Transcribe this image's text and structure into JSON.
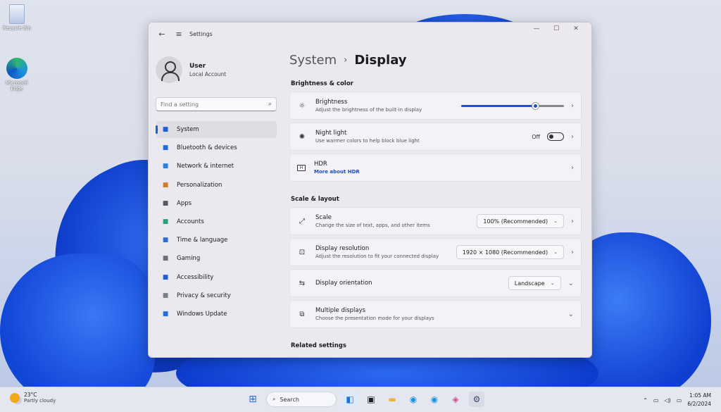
{
  "desktop": {
    "icons": [
      {
        "label": "Recycle Bin"
      },
      {
        "label": "Microsoft Edge"
      }
    ]
  },
  "window": {
    "title": "Settings",
    "controls": {
      "minimize": "—",
      "maximize": "☐",
      "close": "✕"
    }
  },
  "sidebar": {
    "user_name": "User",
    "user_account": "Local Account",
    "search_placeholder": "Find a setting",
    "items": [
      {
        "label": "System",
        "icon": "monitor-icon",
        "color": "#1f5fcf"
      },
      {
        "label": "Bluetooth & devices",
        "icon": "bluetooth-icon",
        "color": "#1f6fd8"
      },
      {
        "label": "Network & internet",
        "icon": "wifi-icon",
        "color": "#2a7fe0"
      },
      {
        "label": "Personalization",
        "icon": "brush-icon",
        "color": "#d07a2a"
      },
      {
        "label": "Apps",
        "icon": "apps-icon",
        "color": "#55595f"
      },
      {
        "label": "Accounts",
        "icon": "person-icon",
        "color": "#2aa07a"
      },
      {
        "label": "Time & language",
        "icon": "globe-icon",
        "color": "#2a6fd8"
      },
      {
        "label": "Gaming",
        "icon": "controller-icon",
        "color": "#6b6f76"
      },
      {
        "label": "Accessibility",
        "icon": "accessibility-icon",
        "color": "#1f5fcf"
      },
      {
        "label": "Privacy & security",
        "icon": "shield-icon",
        "color": "#7a7e86"
      },
      {
        "label": "Windows Update",
        "icon": "update-icon",
        "color": "#1f6fd8"
      }
    ]
  },
  "main": {
    "breadcrumb_parent": "System",
    "breadcrumb_sep": "›",
    "breadcrumb_current": "Display",
    "section_brightness": "Brightness & color",
    "section_scale": "Scale & layout",
    "section_related": "Related settings",
    "brightness": {
      "title": "Brightness",
      "desc": "Adjust the brightness of the built-in display",
      "level": 0.72
    },
    "night_light": {
      "title": "Night light",
      "desc": "Use warmer colors to help block blue light",
      "state": "Off"
    },
    "hdr": {
      "title": "HDR",
      "desc": "More about HDR"
    },
    "scale": {
      "title": "Scale",
      "desc": "Change the size of text, apps, and other items",
      "value": "100% (Recommended)"
    },
    "resolution": {
      "title": "Display resolution",
      "desc": "Adjust the resolution to fit your connected display",
      "value": "1920 × 1080 (Recommended)"
    },
    "orientation": {
      "title": "Display orientation",
      "value": "Landscape"
    },
    "multiple": {
      "title": "Multiple displays",
      "desc": "Choose the presentation mode for your displays"
    }
  },
  "taskbar": {
    "temp": "23°C",
    "weather": "Partly cloudy",
    "search_label": "Search",
    "time": "1:05 AM",
    "date": "6/2/2024"
  }
}
